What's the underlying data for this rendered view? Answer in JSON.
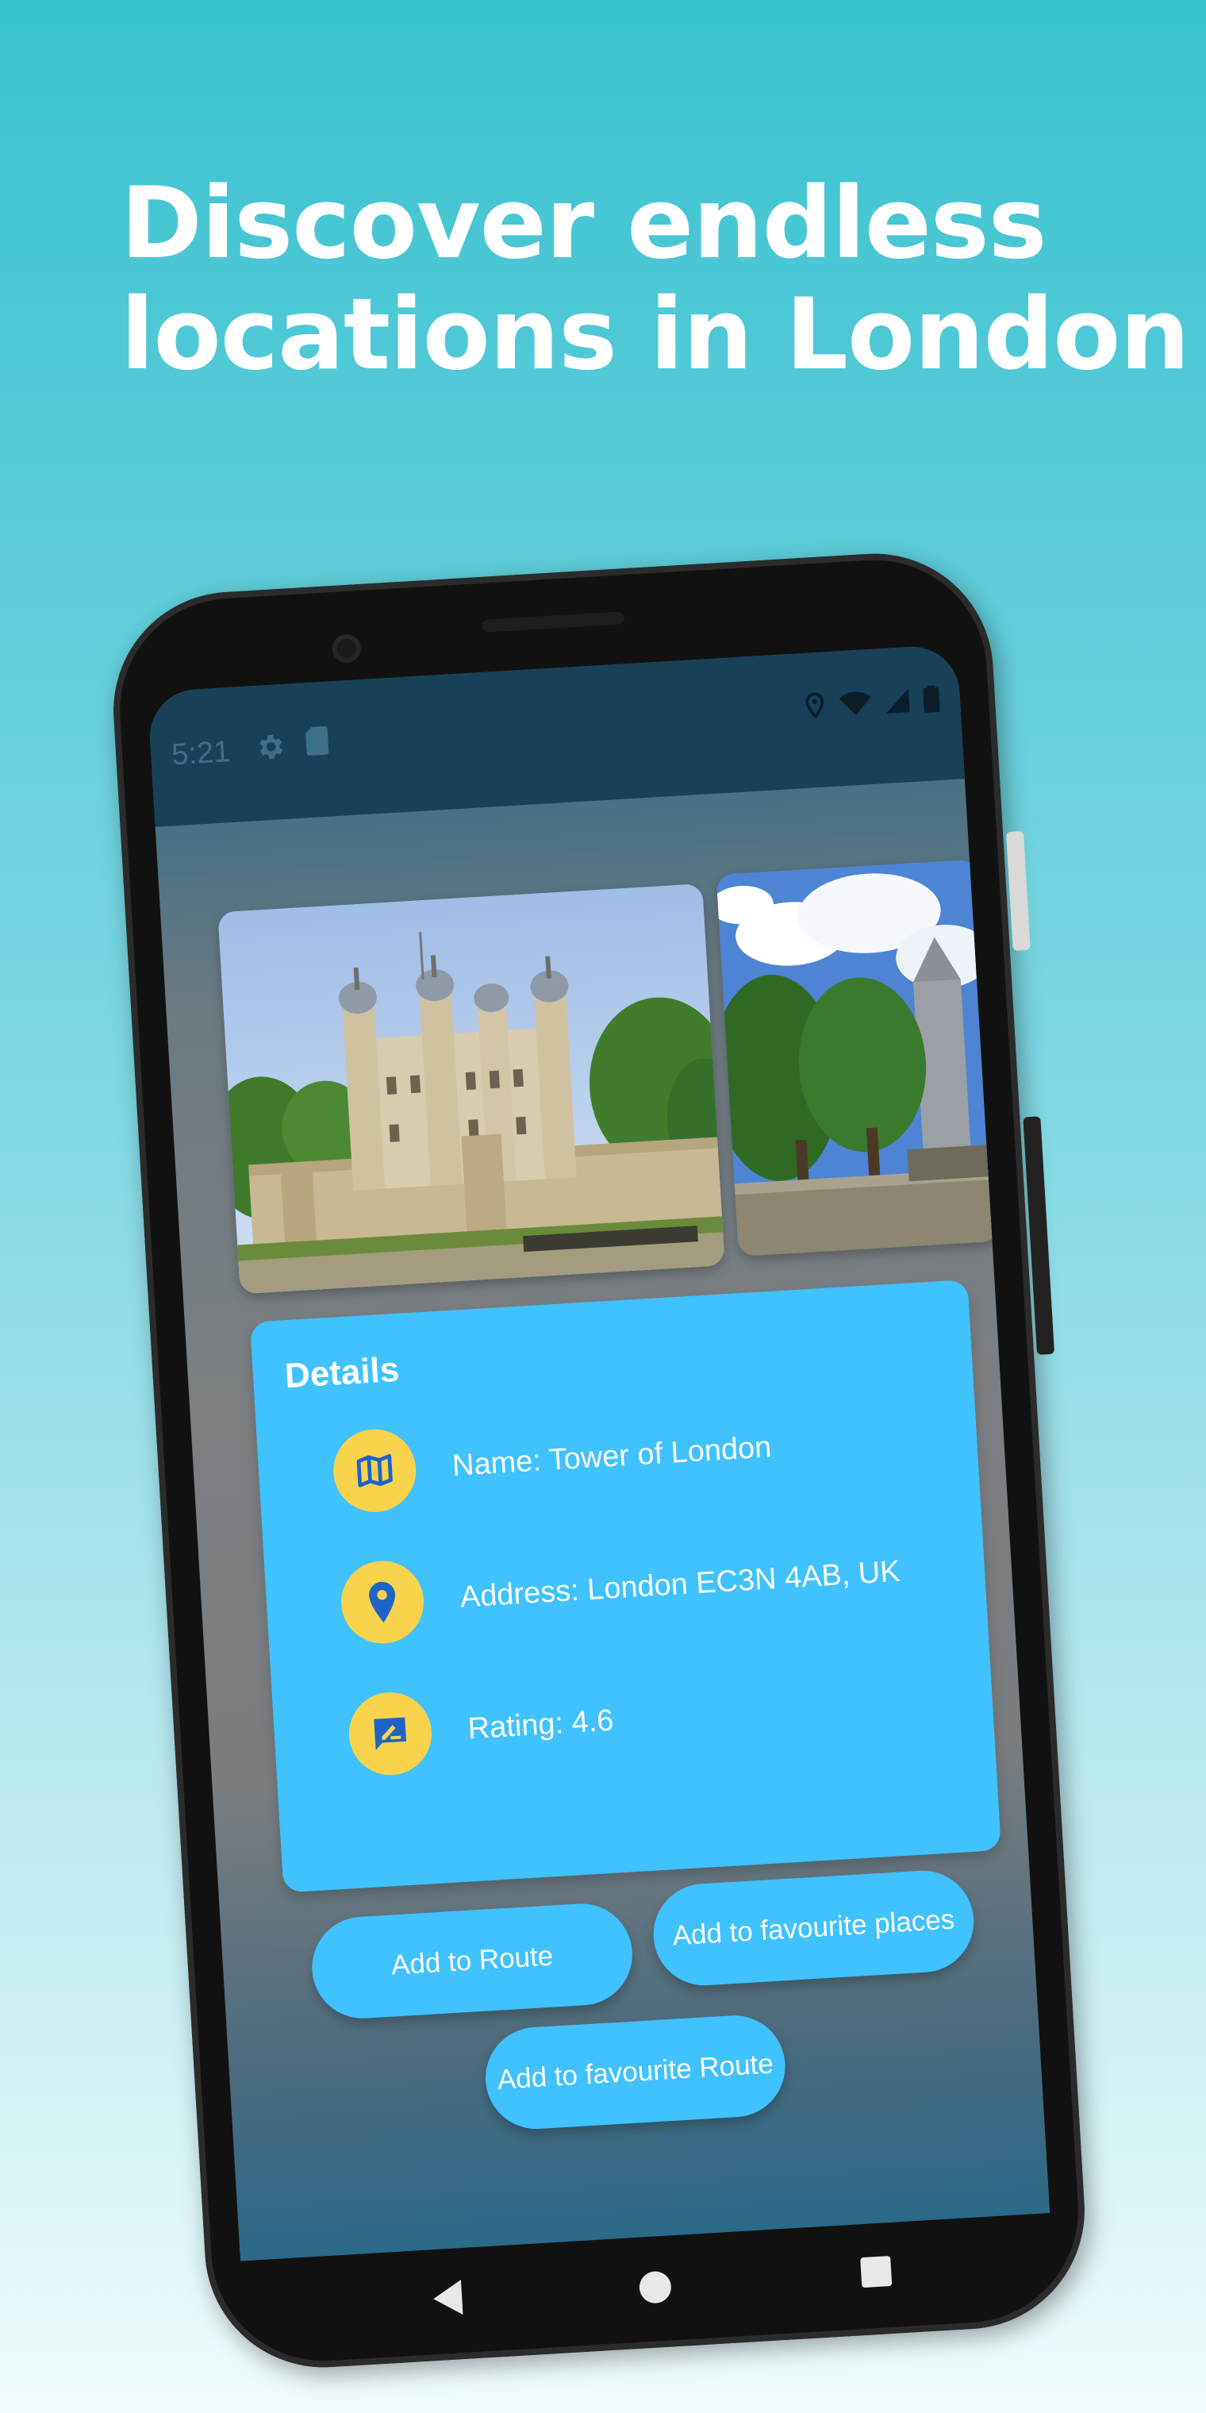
{
  "headline": {
    "line1": "Discover endless",
    "line2": "locations in London"
  },
  "statusbar": {
    "time": "5:21"
  },
  "details": {
    "title": "Details",
    "rows": [
      {
        "icon": "map-icon",
        "text": "Name: Tower of London"
      },
      {
        "icon": "location-pin-icon",
        "text": "Address: London EC3N 4AB, UK"
      },
      {
        "icon": "rate-review-icon",
        "text": "Rating: 4.6"
      }
    ]
  },
  "actions": {
    "add_to_route": "Add to Route",
    "add_to_favourite_places": "Add to favourite places",
    "add_to_favourite_route": "Add to favourite Route"
  },
  "colors": {
    "background_top": "#39c1d0",
    "card": "#3fc2fd",
    "badge": "#f9d34c",
    "icon_blue": "#1e63c8"
  }
}
